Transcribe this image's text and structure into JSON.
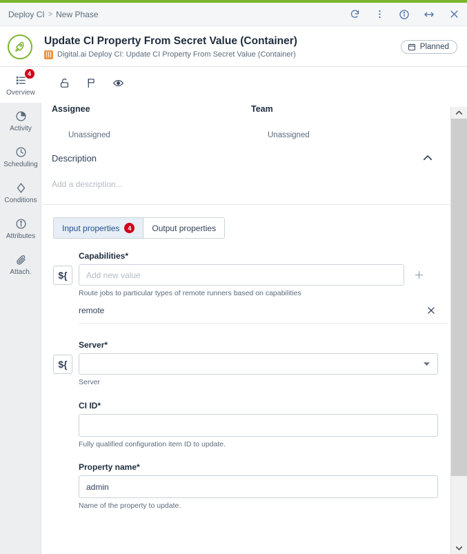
{
  "window": {
    "breadcrumb": {
      "root": "Deploy CI",
      "separator": ">",
      "current": "New Phase"
    },
    "actions": [
      {
        "name": "refresh-icon",
        "label": "Refresh"
      },
      {
        "name": "more-menu-icon",
        "label": "More"
      },
      {
        "name": "info-icon",
        "label": "Info"
      },
      {
        "name": "resize-icon",
        "label": "Resize"
      },
      {
        "name": "close-icon",
        "label": "Close"
      }
    ],
    "accent_green": "#7ab52d"
  },
  "header": {
    "logo_icon": "rocket-icon",
    "title": "Update CI Property From Secret Value (Container)",
    "subtitle_icon": "task-type-icon",
    "subtitle": "Digital.ai Deploy CI: Update CI Property From Secret Value (Container)",
    "status": {
      "label": "Planned",
      "icon": "calendar-icon"
    }
  },
  "sidebar": {
    "items": [
      {
        "label": "Overview",
        "icon": "list-icon",
        "badge": "4",
        "active": true
      },
      {
        "label": "Activity",
        "icon": "pie-clock-icon",
        "badge": "",
        "active": false
      },
      {
        "label": "Scheduling",
        "icon": "clock-icon",
        "badge": "",
        "active": false
      },
      {
        "label": "Conditions",
        "icon": "diamond-icon",
        "badge": "",
        "active": false
      },
      {
        "label": "Attributes",
        "icon": "info-circle-icon",
        "badge": "",
        "active": false
      },
      {
        "label": "Attach.",
        "icon": "paperclip-icon",
        "badge": "",
        "active": false
      }
    ]
  },
  "toolbar": {
    "icons": [
      {
        "name": "unlock-icon",
        "label": "Lock"
      },
      {
        "name": "flag-icon",
        "label": "Flag"
      },
      {
        "name": "eye-icon",
        "label": "Watch"
      }
    ]
  },
  "overview": {
    "assignee_label": "Assignee",
    "assignee_value": "Unassigned",
    "team_label": "Team",
    "team_value": "Unassigned",
    "description_label": "Description",
    "description_placeholder": "Add a description...",
    "collapse_icon": "chevron-up-icon"
  },
  "tabs": [
    {
      "label": "Input properties",
      "badge": "4",
      "active": true
    },
    {
      "label": "Output properties",
      "badge": "",
      "active": false
    }
  ],
  "form": {
    "fields": [
      {
        "label": "Capabilities",
        "required": "*",
        "variable_button": "${",
        "input_value": "",
        "placeholder": "Add new value",
        "hint": "Route jobs to particular types of remote runners based on capabilities",
        "add_icon": "plus-icon",
        "chips": [
          {
            "value": "remote",
            "remove_icon": "close-icon"
          }
        ]
      },
      {
        "label": "Server",
        "required": "*",
        "variable_button": "${",
        "input_value": "",
        "placeholder": "",
        "hint": "Server",
        "dropdown_icon": "caret-down-icon"
      },
      {
        "label": "CI ID",
        "required": "*",
        "input_value": "",
        "placeholder": "",
        "hint": "Fully qualified configuration item ID to update."
      },
      {
        "label": "Property name",
        "required": "*",
        "input_value": "admin",
        "placeholder": "",
        "hint": "Name of the property to update."
      }
    ]
  },
  "scrollbar": {
    "up_icon": "chevron-up-icon",
    "down_icon": "chevron-down-icon"
  }
}
